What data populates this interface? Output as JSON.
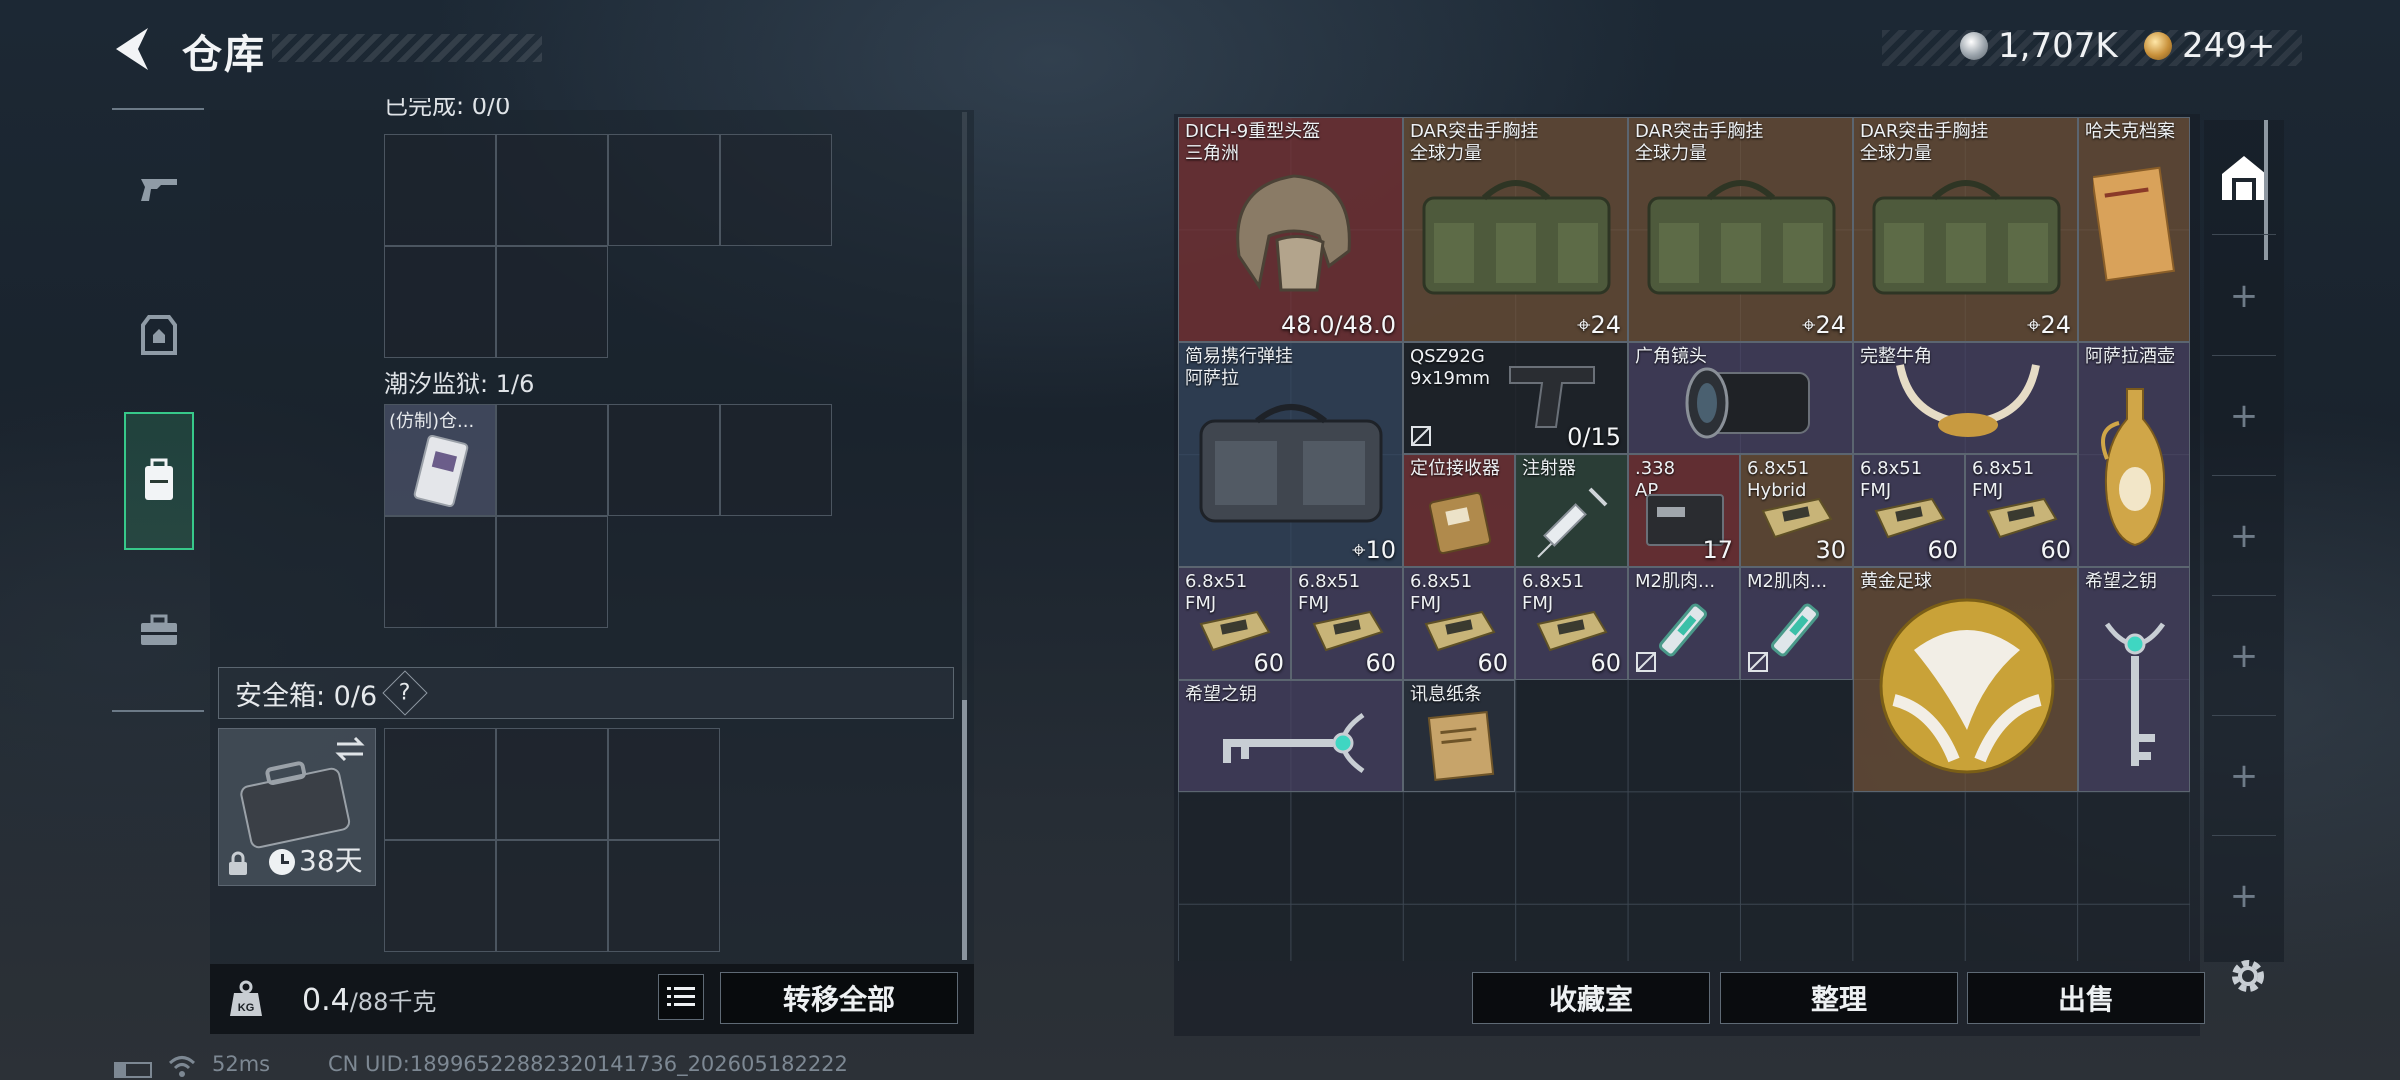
{
  "header": {
    "title": "仓库"
  },
  "currency": {
    "coin_amount": "1,707K",
    "premium_amount": "249+"
  },
  "left_panel": {
    "top_cut_label": "已完成: 0/0",
    "container2_label": "潮汐监狱: 1/6",
    "container2_item": "(仿制)仓...",
    "safe_box_label": "安全箱: 0/6",
    "safe_box_help": "?",
    "safe_case_days": "38天",
    "weight_value": "0.4",
    "weight_max": "/88千克",
    "transfer_all": "转移全部"
  },
  "items": [
    {
      "name": "DICH-9重型头盔\n三角洲",
      "qty": "48.0/48.0",
      "icon": "helmet",
      "rarity": "red"
    },
    {
      "name": "DAR突击手胸挂\n全球力量",
      "qty": "24",
      "icon": "chest-rig",
      "rarity": "orange"
    },
    {
      "name": "DAR突击手胸挂\n全球力量",
      "qty": "24",
      "icon": "chest-rig",
      "rarity": "orange"
    },
    {
      "name": "DAR突击手胸挂\n全球力量",
      "qty": "24",
      "icon": "chest-rig",
      "rarity": "orange"
    },
    {
      "name": "哈夫克档案",
      "qty": "",
      "icon": "file",
      "rarity": "orange"
    },
    {
      "name": "简易携行弹挂\n阿萨拉",
      "qty": "10",
      "icon": "bag",
      "rarity": "blue"
    },
    {
      "name": "QSZ92G\n9x19mm",
      "qty": "0/15",
      "icon": "pistol",
      "rarity": "dark"
    },
    {
      "name": "广角镜头",
      "qty": "",
      "icon": "lens",
      "rarity": "purple"
    },
    {
      "name": "完整牛角",
      "qty": "",
      "icon": "horns",
      "rarity": "purple"
    },
    {
      "name": "阿萨拉酒壶",
      "qty": "",
      "icon": "jug",
      "rarity": "purple"
    },
    {
      "name": "定位接收器",
      "qty": "",
      "icon": "receiver",
      "rarity": "red"
    },
    {
      "name": "注射器",
      "qty": "",
      "icon": "syringe",
      "rarity": "green"
    },
    {
      "name": ".338\nAP",
      "qty": "17",
      "icon": "ammo-box",
      "rarity": "red"
    },
    {
      "name": "6.8x51\nHybrid",
      "qty": "30",
      "icon": "ammo",
      "rarity": "orange"
    },
    {
      "name": "6.8x51\nFMJ",
      "qty": "60",
      "icon": "ammo",
      "rarity": "purple"
    },
    {
      "name": "6.8x51\nFMJ",
      "qty": "60",
      "icon": "ammo",
      "rarity": "purple"
    },
    {
      "name": "6.8x51\nFMJ",
      "qty": "60",
      "icon": "ammo",
      "rarity": "purple"
    },
    {
      "name": "6.8x51\nFMJ",
      "qty": "60",
      "icon": "ammo",
      "rarity": "purple"
    },
    {
      "name": "6.8x51\nFMJ",
      "qty": "60",
      "icon": "ammo",
      "rarity": "purple"
    },
    {
      "name": "6.8x51\nFMJ",
      "qty": "60",
      "icon": "ammo",
      "rarity": "purple"
    },
    {
      "name": "M2肌肉...",
      "qty": "",
      "icon": "injector",
      "rarity": "purple"
    },
    {
      "name": "M2肌肉...",
      "qty": "",
      "icon": "injector",
      "rarity": "purple"
    },
    {
      "name": "黄金足球",
      "qty": "",
      "icon": "golden-ball",
      "rarity": "orange"
    },
    {
      "name": "希望之钥",
      "qty": "",
      "icon": "key",
      "rarity": "purple"
    },
    {
      "name": "希望之钥",
      "qty": "",
      "icon": "key",
      "rarity": "purple"
    },
    {
      "name": "讯息纸条",
      "qty": "",
      "icon": "note",
      "rarity": "plain"
    }
  ],
  "buttons": {
    "collection": "收藏室",
    "sort": "整理",
    "sell": "出售"
  },
  "status": {
    "ping": "52ms",
    "uid": "CN UID:18996522882320141736_202605182222"
  },
  "colors": {
    "accent_green": "#37c98a",
    "rarity_red": "#76323a",
    "rarity_orange": "#705238",
    "rarity_purple": "#4a4264"
  }
}
